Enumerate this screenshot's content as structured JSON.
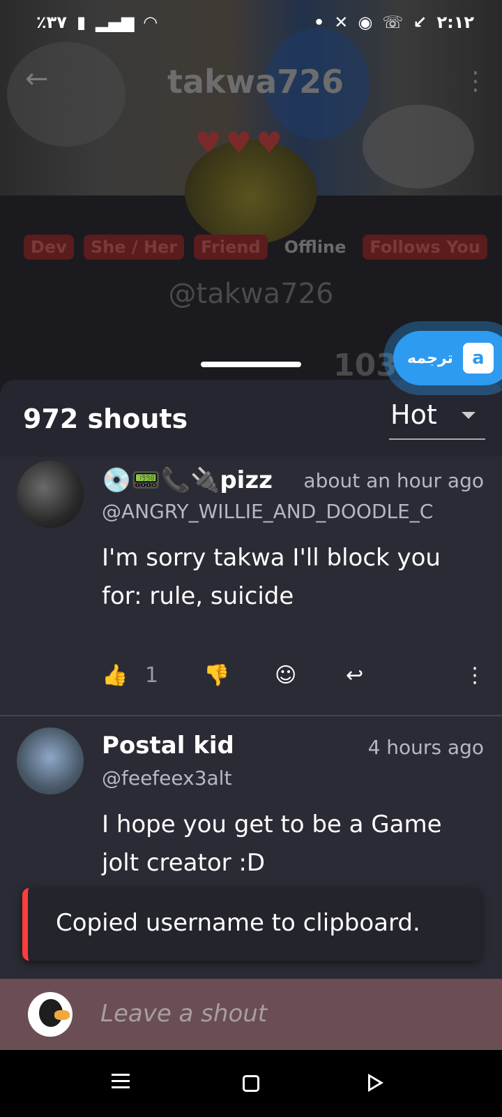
{
  "status_bar": {
    "battery": "٪۳۷",
    "time": "۲:۱۲"
  },
  "profile": {
    "name": "takwa726",
    "handle": "@takwa726",
    "tags": [
      "Dev",
      "She / Her",
      "Friend",
      "Offline",
      "Follows You"
    ],
    "peek_count": "103."
  },
  "translate": {
    "label": "ترجمه",
    "icon": "translate-icon"
  },
  "shouts": {
    "count_label": "972 shouts",
    "sort": {
      "selected": "Hot"
    },
    "items": [
      {
        "display_name": "💿📟📞🔌pizz",
        "username": "@ANGRY_WILLIE_AND_DOODLE_C",
        "time": "about an hour ago",
        "message": "I'm sorry takwa I'll block you for: rule, suicide",
        "likes": "1"
      },
      {
        "display_name": "Postal kid",
        "username": "@feefeex3alt",
        "time": "4 hours ago",
        "message": "I hope you get to be a Game jolt creator :D"
      }
    ]
  },
  "toast": {
    "text": "Copied username to clipboard."
  },
  "composer": {
    "placeholder": "Leave a shout"
  },
  "colors": {
    "sheet": "#2b2b35",
    "accent_red": "#ff3d3d",
    "composer": "#6a4e53",
    "translate": "#2d9bf0"
  }
}
